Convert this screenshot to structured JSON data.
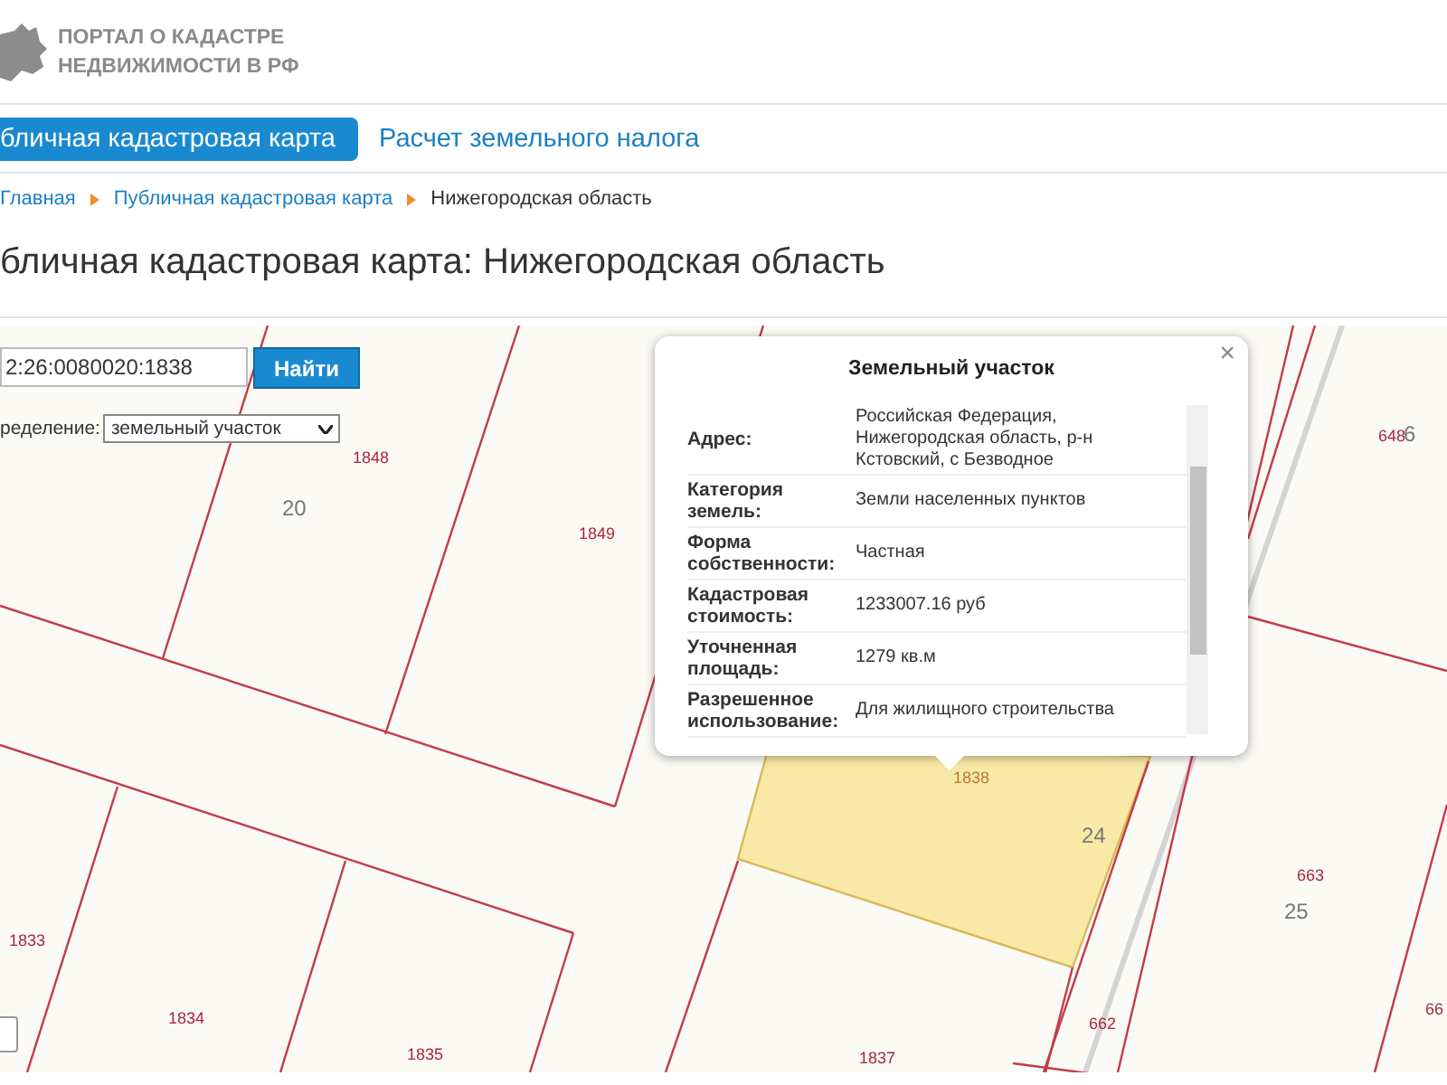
{
  "header": {
    "logo_lines": [
      "ПОРТАЛ О КАДАСТРЕ",
      "НЕДВИЖИМОСТИ В РФ"
    ]
  },
  "nav": [
    {
      "label": "бличная кадастровая карта",
      "selected": true
    },
    {
      "label": "Расчет земельного налога",
      "selected": false
    }
  ],
  "breadcrumbs": [
    "Главная",
    "Публичная кадастровая карта",
    "Нижегородская область"
  ],
  "title": "бличная кадастровая карта: Нижегородская область",
  "map": {
    "search": {
      "value": "2:26:0080020:1838",
      "button": "Найти"
    },
    "filter": {
      "label": "ределение:",
      "value": "земельный участок"
    },
    "parcels": [
      {
        "kind": "parcel",
        "number": "1848",
        "selected": false
      },
      {
        "kind": "block",
        "number": "20",
        "selected": false
      },
      {
        "kind": "parcel",
        "number": "1849",
        "selected": false
      },
      {
        "kind": "parcel",
        "number": "1833",
        "selected": false
      },
      {
        "kind": "parcel",
        "number": "1834",
        "selected": false
      },
      {
        "kind": "parcel",
        "number": "1835",
        "selected": false
      },
      {
        "kind": "parcel",
        "number": "1837",
        "selected": false
      },
      {
        "kind": "parcel",
        "number": "1838",
        "selected": true
      },
      {
        "kind": "block",
        "number": "24",
        "selected": false
      },
      {
        "kind": "parcel",
        "number": "648",
        "selected": false
      },
      {
        "kind": "block",
        "number": "6",
        "selected": false
      },
      {
        "kind": "parcel",
        "number": "663",
        "selected": false
      },
      {
        "kind": "block",
        "number": "25",
        "selected": false
      },
      {
        "kind": "parcel",
        "number": "662",
        "selected": false
      },
      {
        "kind": "parcel",
        "number": "66",
        "selected": false
      }
    ],
    "popup": {
      "title": "Земельный участок",
      "close": "×",
      "rows": [
        {
          "label": "Адрес:",
          "value": "Российская Федерация, Нижегородская область, р-н Кстовский, с Безводное"
        },
        {
          "label": "Категория земель:",
          "value": "Земли населенных пунктов"
        },
        {
          "label": "Форма собственности:",
          "value": "Частная"
        },
        {
          "label": "Кадастровая стоимость:",
          "value": "1233007.16 руб"
        },
        {
          "label": "Уточненная площадь:",
          "value": "1279 кв.м"
        },
        {
          "label": "Разрешенное использование:",
          "value": "Для жилищного строительства"
        }
      ]
    }
  }
}
